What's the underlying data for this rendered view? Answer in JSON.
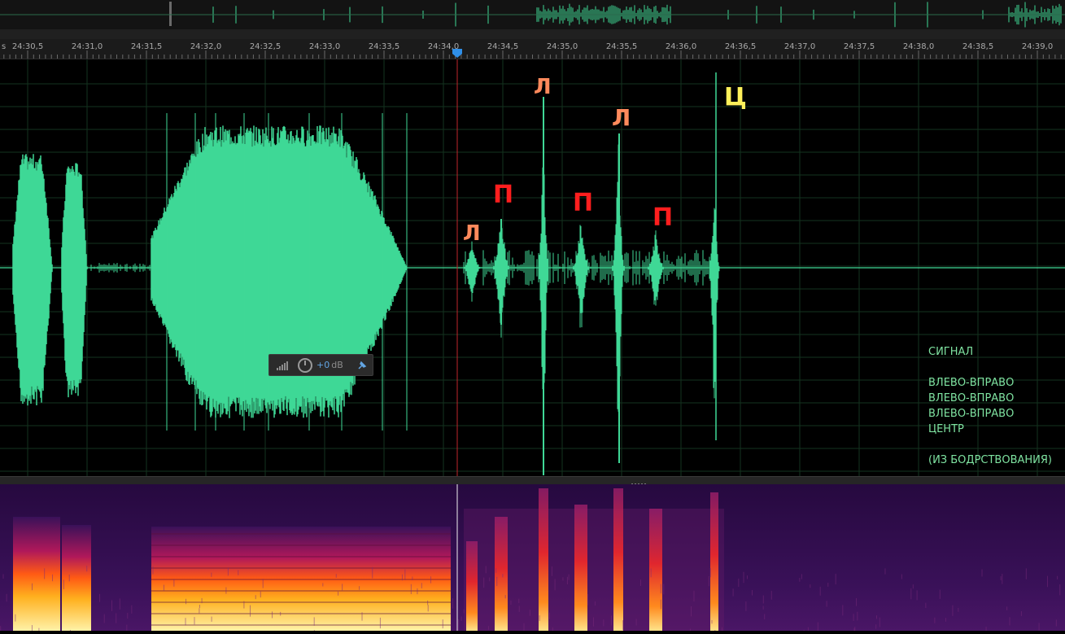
{
  "window": {
    "ruler": {
      "labels": [
        "24:30,5",
        "24:31,0",
        "24:31,5",
        "24:32,0",
        "24:32,5",
        "24:33,0",
        "24:33,5",
        "24:34,0",
        "24:34,5",
        "24:35,0",
        "24:35,5",
        "24:36,0",
        "24:36,5",
        "24:37,0",
        "24:37,5",
        "24:38,0",
        "24:38,5",
        "24:39,0"
      ],
      "left_fragment": "s"
    },
    "hud": {
      "gain_value": "+0",
      "gain_unit": "dB",
      "icons": [
        "level-meter-icon",
        "volume-knob-icon",
        "pin-icon"
      ]
    },
    "annotations": {
      "markers": [
        {
          "text": "Л",
          "color": "#ff8a5c"
        },
        {
          "text": "П",
          "color": "#ff1e1e"
        },
        {
          "text": "Л",
          "color": "#ff8a5c"
        },
        {
          "text": "П",
          "color": "#ff1e1e"
        },
        {
          "text": "Л",
          "color": "#ff8a5c"
        },
        {
          "text": "П",
          "color": "#ff1e1e"
        },
        {
          "text": "Ц",
          "color": "#fff05a"
        }
      ],
      "legend": [
        "СИГНАЛ",
        "",
        "ВЛЕВО-ВПРАВО",
        "ВЛЕВО-ВПРАВО",
        "ВЛЕВО-ВПРАВО",
        "ЦЕНТР",
        "",
        "(ИЗ БОДРСТВОВАНИЯ)"
      ]
    },
    "colors": {
      "waveform": "#3fd896",
      "playhead": "#c0262c",
      "playhead_handle": "#2f8fe8",
      "legend_text": "#7fe3a1",
      "spectrogram_base": "#2b0c4a"
    }
  }
}
